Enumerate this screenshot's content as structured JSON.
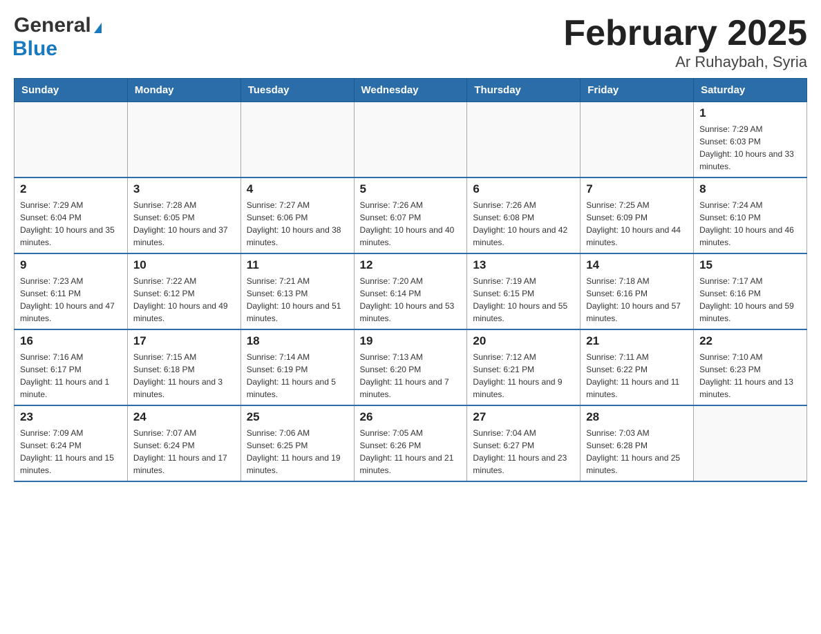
{
  "header": {
    "logo_general": "General",
    "logo_blue": "Blue",
    "title": "February 2025",
    "subtitle": "Ar Ruhaybah, Syria"
  },
  "weekdays": [
    "Sunday",
    "Monday",
    "Tuesday",
    "Wednesday",
    "Thursday",
    "Friday",
    "Saturday"
  ],
  "weeks": [
    [
      {
        "day": "",
        "sunrise": "",
        "sunset": "",
        "daylight": ""
      },
      {
        "day": "",
        "sunrise": "",
        "sunset": "",
        "daylight": ""
      },
      {
        "day": "",
        "sunrise": "",
        "sunset": "",
        "daylight": ""
      },
      {
        "day": "",
        "sunrise": "",
        "sunset": "",
        "daylight": ""
      },
      {
        "day": "",
        "sunrise": "",
        "sunset": "",
        "daylight": ""
      },
      {
        "day": "",
        "sunrise": "",
        "sunset": "",
        "daylight": ""
      },
      {
        "day": "1",
        "sunrise": "Sunrise: 7:29 AM",
        "sunset": "Sunset: 6:03 PM",
        "daylight": "Daylight: 10 hours and 33 minutes."
      }
    ],
    [
      {
        "day": "2",
        "sunrise": "Sunrise: 7:29 AM",
        "sunset": "Sunset: 6:04 PM",
        "daylight": "Daylight: 10 hours and 35 minutes."
      },
      {
        "day": "3",
        "sunrise": "Sunrise: 7:28 AM",
        "sunset": "Sunset: 6:05 PM",
        "daylight": "Daylight: 10 hours and 37 minutes."
      },
      {
        "day": "4",
        "sunrise": "Sunrise: 7:27 AM",
        "sunset": "Sunset: 6:06 PM",
        "daylight": "Daylight: 10 hours and 38 minutes."
      },
      {
        "day": "5",
        "sunrise": "Sunrise: 7:26 AM",
        "sunset": "Sunset: 6:07 PM",
        "daylight": "Daylight: 10 hours and 40 minutes."
      },
      {
        "day": "6",
        "sunrise": "Sunrise: 7:26 AM",
        "sunset": "Sunset: 6:08 PM",
        "daylight": "Daylight: 10 hours and 42 minutes."
      },
      {
        "day": "7",
        "sunrise": "Sunrise: 7:25 AM",
        "sunset": "Sunset: 6:09 PM",
        "daylight": "Daylight: 10 hours and 44 minutes."
      },
      {
        "day": "8",
        "sunrise": "Sunrise: 7:24 AM",
        "sunset": "Sunset: 6:10 PM",
        "daylight": "Daylight: 10 hours and 46 minutes."
      }
    ],
    [
      {
        "day": "9",
        "sunrise": "Sunrise: 7:23 AM",
        "sunset": "Sunset: 6:11 PM",
        "daylight": "Daylight: 10 hours and 47 minutes."
      },
      {
        "day": "10",
        "sunrise": "Sunrise: 7:22 AM",
        "sunset": "Sunset: 6:12 PM",
        "daylight": "Daylight: 10 hours and 49 minutes."
      },
      {
        "day": "11",
        "sunrise": "Sunrise: 7:21 AM",
        "sunset": "Sunset: 6:13 PM",
        "daylight": "Daylight: 10 hours and 51 minutes."
      },
      {
        "day": "12",
        "sunrise": "Sunrise: 7:20 AM",
        "sunset": "Sunset: 6:14 PM",
        "daylight": "Daylight: 10 hours and 53 minutes."
      },
      {
        "day": "13",
        "sunrise": "Sunrise: 7:19 AM",
        "sunset": "Sunset: 6:15 PM",
        "daylight": "Daylight: 10 hours and 55 minutes."
      },
      {
        "day": "14",
        "sunrise": "Sunrise: 7:18 AM",
        "sunset": "Sunset: 6:16 PM",
        "daylight": "Daylight: 10 hours and 57 minutes."
      },
      {
        "day": "15",
        "sunrise": "Sunrise: 7:17 AM",
        "sunset": "Sunset: 6:16 PM",
        "daylight": "Daylight: 10 hours and 59 minutes."
      }
    ],
    [
      {
        "day": "16",
        "sunrise": "Sunrise: 7:16 AM",
        "sunset": "Sunset: 6:17 PM",
        "daylight": "Daylight: 11 hours and 1 minute."
      },
      {
        "day": "17",
        "sunrise": "Sunrise: 7:15 AM",
        "sunset": "Sunset: 6:18 PM",
        "daylight": "Daylight: 11 hours and 3 minutes."
      },
      {
        "day": "18",
        "sunrise": "Sunrise: 7:14 AM",
        "sunset": "Sunset: 6:19 PM",
        "daylight": "Daylight: 11 hours and 5 minutes."
      },
      {
        "day": "19",
        "sunrise": "Sunrise: 7:13 AM",
        "sunset": "Sunset: 6:20 PM",
        "daylight": "Daylight: 11 hours and 7 minutes."
      },
      {
        "day": "20",
        "sunrise": "Sunrise: 7:12 AM",
        "sunset": "Sunset: 6:21 PM",
        "daylight": "Daylight: 11 hours and 9 minutes."
      },
      {
        "day": "21",
        "sunrise": "Sunrise: 7:11 AM",
        "sunset": "Sunset: 6:22 PM",
        "daylight": "Daylight: 11 hours and 11 minutes."
      },
      {
        "day": "22",
        "sunrise": "Sunrise: 7:10 AM",
        "sunset": "Sunset: 6:23 PM",
        "daylight": "Daylight: 11 hours and 13 minutes."
      }
    ],
    [
      {
        "day": "23",
        "sunrise": "Sunrise: 7:09 AM",
        "sunset": "Sunset: 6:24 PM",
        "daylight": "Daylight: 11 hours and 15 minutes."
      },
      {
        "day": "24",
        "sunrise": "Sunrise: 7:07 AM",
        "sunset": "Sunset: 6:24 PM",
        "daylight": "Daylight: 11 hours and 17 minutes."
      },
      {
        "day": "25",
        "sunrise": "Sunrise: 7:06 AM",
        "sunset": "Sunset: 6:25 PM",
        "daylight": "Daylight: 11 hours and 19 minutes."
      },
      {
        "day": "26",
        "sunrise": "Sunrise: 7:05 AM",
        "sunset": "Sunset: 6:26 PM",
        "daylight": "Daylight: 11 hours and 21 minutes."
      },
      {
        "day": "27",
        "sunrise": "Sunrise: 7:04 AM",
        "sunset": "Sunset: 6:27 PM",
        "daylight": "Daylight: 11 hours and 23 minutes."
      },
      {
        "day": "28",
        "sunrise": "Sunrise: 7:03 AM",
        "sunset": "Sunset: 6:28 PM",
        "daylight": "Daylight: 11 hours and 25 minutes."
      },
      {
        "day": "",
        "sunrise": "",
        "sunset": "",
        "daylight": ""
      }
    ]
  ]
}
